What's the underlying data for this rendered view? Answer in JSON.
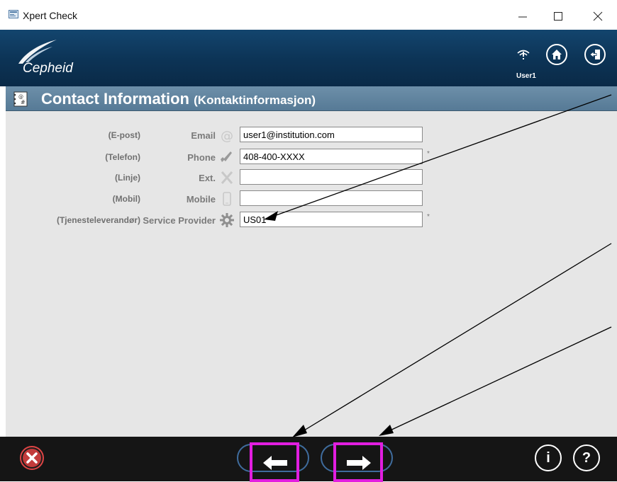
{
  "window": {
    "title": "Xpert Check",
    "controls": [
      "minimize",
      "maximize",
      "close"
    ]
  },
  "header": {
    "brand": "Cepheid",
    "user_label": "User1",
    "icons": [
      "network-warning-icon",
      "home-icon",
      "logout-icon"
    ]
  },
  "section": {
    "title": "Contact Information",
    "subtitle": "(Kontaktinformasjon)"
  },
  "form": {
    "fields": [
      {
        "translation": "(E-post)",
        "label": "Email",
        "value": "user1@institution.com",
        "required": false,
        "icon": "at-icon"
      },
      {
        "translation": "(Telefon)",
        "label": "Phone",
        "value": "408-400-XXXX",
        "required": true,
        "icon": "phone-icon"
      },
      {
        "translation": "(Linje)",
        "label": "Ext.",
        "value": "",
        "required": false,
        "icon": "extension-icon"
      },
      {
        "translation": "(Mobil)",
        "label": "Mobile",
        "value": "",
        "required": false,
        "icon": "mobile-icon"
      },
      {
        "translation": "(Tjenesteleverandør)",
        "label": "Service Provider",
        "value": "US01",
        "required": true,
        "icon": "gear-icon"
      }
    ],
    "required_marker": "*"
  },
  "footer": {
    "cancel_icon": "cancel-icon",
    "back_icon": "arrow-left-icon",
    "next_icon": "arrow-right-icon",
    "info_label": "i",
    "help_label": "?"
  },
  "colors": {
    "header": "#0c3355",
    "section_bar": "#5f819c",
    "panel": "#e6e6e6",
    "footer": "#151515",
    "highlight": "#e21ee0",
    "cancel": "#dd4444"
  }
}
